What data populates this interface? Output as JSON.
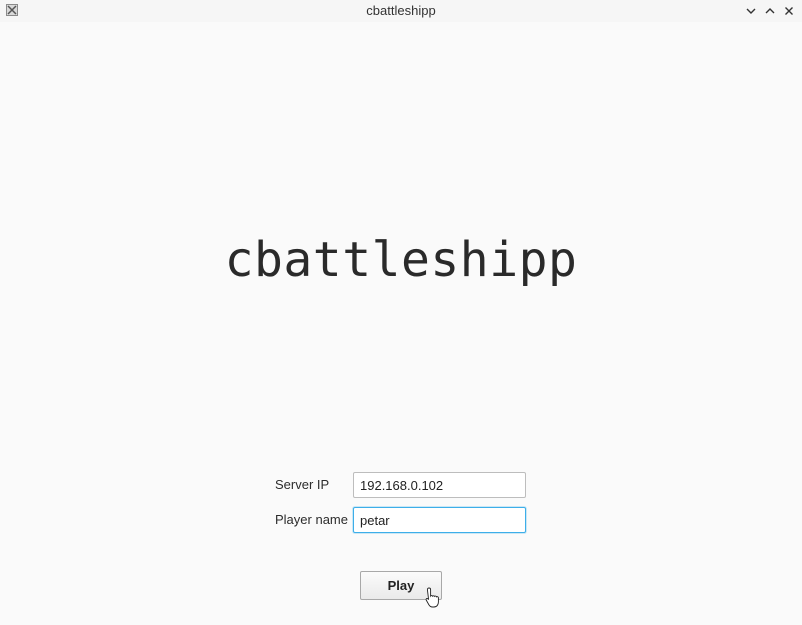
{
  "window": {
    "title": "cbattleshipp",
    "icon": "x11-app-icon",
    "controls": [
      "chevron-down-icon",
      "chevron-up-icon",
      "close-icon"
    ]
  },
  "main": {
    "logo_text": "cbattleshipp"
  },
  "form": {
    "server_ip_label": "Server IP",
    "server_ip_value": "192.168.0.102",
    "player_name_label": "Player name",
    "player_name_value": "petar",
    "play_button_label": "Play"
  },
  "colors": {
    "background": "#fafafa",
    "focus_border": "#3daee9",
    "text": "#2a2a2a"
  }
}
